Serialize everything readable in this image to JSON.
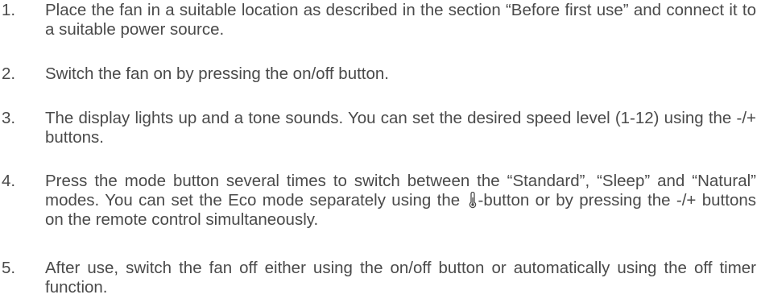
{
  "steps": [
    {
      "number": "1.",
      "text": "Place the fan in a suitable location as described in the section “Before first use” and connect it to a suitable power source."
    },
    {
      "number": "2.",
      "text": "Switch the fan on by pressing the on/off button."
    },
    {
      "number": "3.",
      "text": "The display lights up and a tone sounds. You can set the desired speed level (1-12) using the -/+ buttons."
    },
    {
      "number": "4.",
      "text_before_icon": "Press the mode button several times to switch between the “Standard”, “Sleep” and “Natural” modes. You can set the Eco mode separately using the ",
      "icon": "thermometer-icon",
      "text_after_icon": "-button or by pressing the -/+ buttons on the remote control simultaneously."
    },
    {
      "number": "5.",
      "text": "After use, switch the fan off either using the on/off button or automatically using the off timer function."
    }
  ]
}
